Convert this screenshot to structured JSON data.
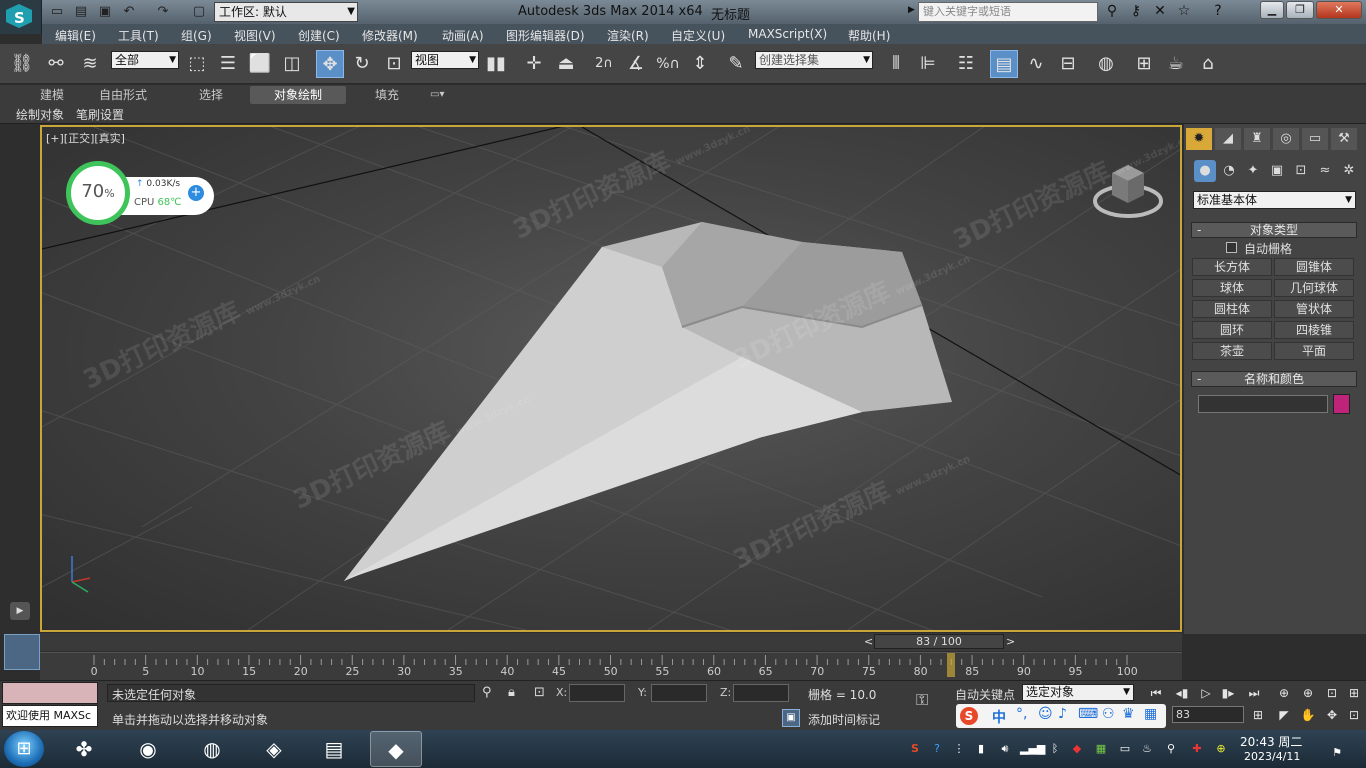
{
  "titlebar": {
    "workspace_label": "工作区: 默认",
    "app_title": "Autodesk 3ds Max  2014 x64",
    "doc_title": "无标题",
    "help_search_placeholder": "键入关键字或短语"
  },
  "menubar": {
    "items": [
      "编辑(E)",
      "工具(T)",
      "组(G)",
      "视图(V)",
      "创建(C)",
      "修改器(M)",
      "动画(A)",
      "图形编辑器(D)",
      "渲染(R)",
      "自定义(U)",
      "MAXScript(X)",
      "帮助(H)"
    ]
  },
  "toolbar": {
    "selection_filter": "全部",
    "ref_coord": "视图",
    "named_selection_placeholder": "创建选择集",
    "snap_labels": [
      "2",
      "%"
    ]
  },
  "ribbon": {
    "tabs": [
      "建模",
      "自由形式",
      "选择",
      "对象绘制",
      "填充"
    ],
    "active_tab": "对象绘制",
    "sub_tabs": [
      "绘制对象",
      "笔刷设置"
    ]
  },
  "viewport": {
    "label": "[+][正交][真实]",
    "watermark": "3D打印资源库",
    "watermark_url": "www.3dzyk.cn"
  },
  "cpu_widget": {
    "percent": "70",
    "percent_unit": "%",
    "speed": "0.03K/s",
    "cpu_label": "CPU",
    "cpu_temp": "68℃"
  },
  "command_panel": {
    "category": "标准基本体",
    "rollout_object_type": "对象类型",
    "autogrid_label": "自动栅格",
    "object_buttons": [
      "长方体",
      "圆锥体",
      "球体",
      "几何球体",
      "圆柱体",
      "管状体",
      "圆环",
      "四棱锥",
      "茶壶",
      "平面"
    ],
    "rollout_name_color": "名称和颜色",
    "object_color": "#c0247a"
  },
  "timeline": {
    "frame_counter": "83 / 100",
    "prev": "<",
    "next": ">",
    "ticks": [
      "0",
      "5",
      "10",
      "15",
      "20",
      "25",
      "30",
      "35",
      "40",
      "45",
      "50",
      "55",
      "60",
      "65",
      "70",
      "75",
      "80",
      "85",
      "90",
      "95",
      "100"
    ],
    "current_frame": 83,
    "total_frames": 100
  },
  "statusbar": {
    "maxscript_label": "欢迎使用 MAXSc",
    "selection_status": "未选定任何对象",
    "prompt": "单击并拖动以选择并移动对象",
    "x_label": "X:",
    "y_label": "Y:",
    "z_label": "Z:",
    "grid": "栅格 = 10.0",
    "add_time_tag": "添加时间标记",
    "auto_key": "自动关键点",
    "set_key_filter": "选定对象",
    "frame_field": "83"
  },
  "taskbar": {
    "time": "20:43 周二",
    "date": "2023/4/11",
    "ime_label": "中"
  }
}
